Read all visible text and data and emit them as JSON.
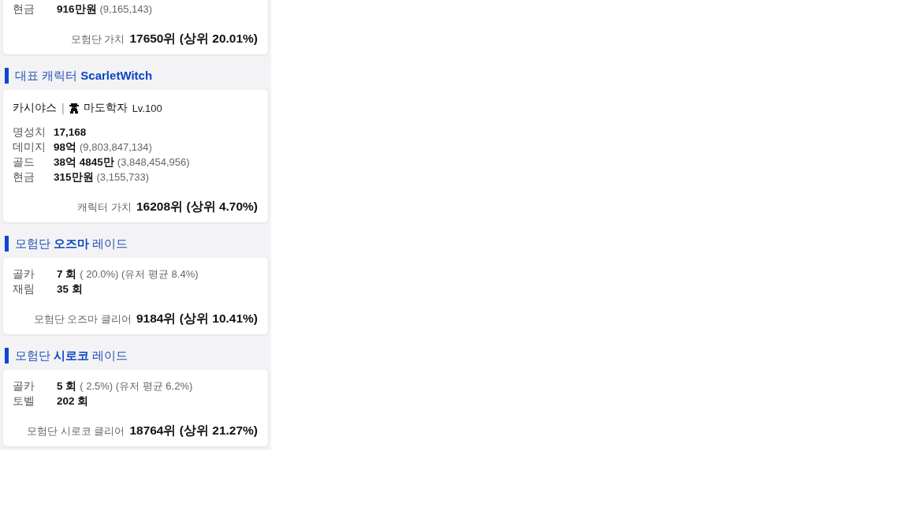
{
  "top_card": {
    "rows": [
      {
        "label": "현금",
        "value": "916만원",
        "detail": "(9,165,143)"
      }
    ],
    "footer": {
      "label": "모험단 가치",
      "value": "17650위 (상위 20.01%)"
    }
  },
  "sections": [
    {
      "title": "대표 캐릭터 **ScarletWitch**",
      "card": {
        "header": {
          "server": "카시야스",
          "separator": "|",
          "class_name": "마도학자",
          "level": "Lv.100"
        },
        "rows": [
          {
            "label": "명성치",
            "value": "17,168"
          },
          {
            "label": "데미지",
            "value": "98억",
            "detail": "(9,803,847,134)"
          },
          {
            "label": "골드",
            "value": "38억 4845만",
            "detail": "(3,848,454,956)"
          },
          {
            "label": "현금",
            "value": "315만원",
            "detail": "(3,155,733)"
          }
        ],
        "footer": {
          "label": "캐릭터 가치",
          "value": "16208위 (상위 4.70%)"
        }
      }
    },
    {
      "title": "모험단 **오즈마** 레이드",
      "card": {
        "rows": [
          {
            "label": "골카",
            "value": "7 회",
            "detail": "( 20.0%) (유저 평균 8.4%)"
          },
          {
            "label": "재림",
            "value": "35 회"
          }
        ],
        "footer": {
          "label": "모험단 오즈마 클리어",
          "value": "9184위 (상위 10.41%)"
        }
      }
    },
    {
      "title": "모험단 **시로코** 레이드",
      "card": {
        "rows": [
          {
            "label": "골카",
            "value": "5 회",
            "detail": "( 2.5%) (유저 평균 6.2%)"
          },
          {
            "label": "토벨",
            "value": "202 회"
          }
        ],
        "footer": {
          "label": "모험단 시로코 클리어",
          "value": "18764위 (상위 21.27%)"
        }
      }
    }
  ]
}
